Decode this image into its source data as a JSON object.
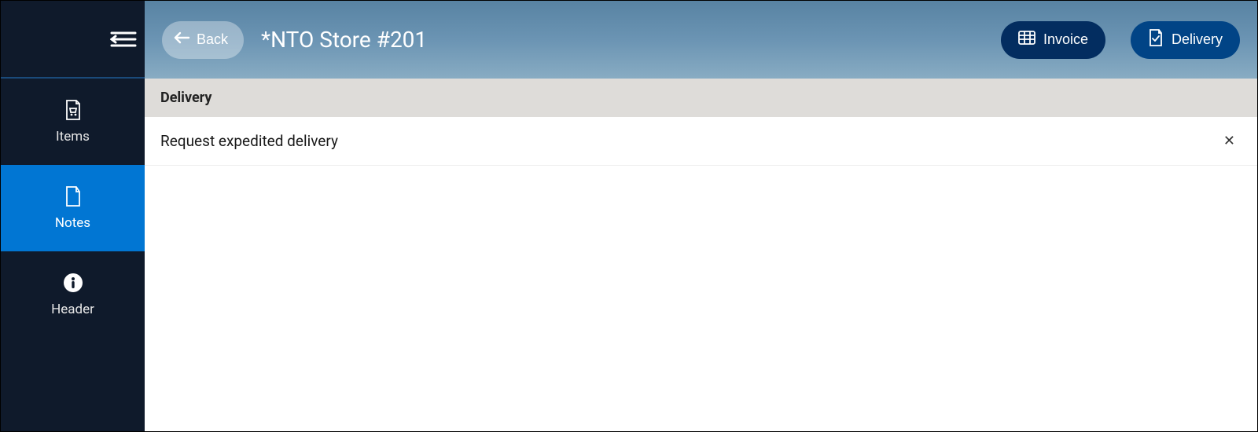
{
  "sidebar": {
    "items": [
      {
        "label": "Items"
      },
      {
        "label": "Notes"
      },
      {
        "label": "Header"
      }
    ]
  },
  "header": {
    "back_label": "Back",
    "title": "*NTO Store #201",
    "invoice_label": "Invoice",
    "delivery_label": "Delivery"
  },
  "section": {
    "title": "Delivery"
  },
  "notes": [
    {
      "text": "Request expedited delivery"
    }
  ]
}
